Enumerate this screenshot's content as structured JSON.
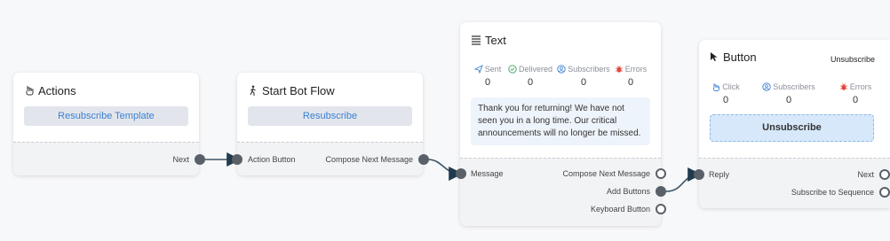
{
  "colors": {
    "accent": "#3b7fd1",
    "port": "#5a6068",
    "wire": "#3b5567",
    "error": "#e0483e",
    "success": "#3aa05b"
  },
  "nodes": {
    "actions": {
      "title": "Actions",
      "icon": "hand-pointer-icon",
      "button": "Resubscribe Template",
      "ports": {
        "next": "Next"
      }
    },
    "start_bot_flow": {
      "title": "Start Bot Flow",
      "icon": "walking-person-icon",
      "button": "Resubscribe",
      "ports": {
        "action_button": "Action Button",
        "compose_next": "Compose Next Message"
      }
    },
    "text": {
      "title": "Text",
      "icon": "lines-icon",
      "stats": [
        {
          "label": "Sent",
          "value": "0",
          "icon": "send-icon"
        },
        {
          "label": "Delivered",
          "value": "0",
          "icon": "check-circle-icon"
        },
        {
          "label": "Subscribers",
          "value": "0",
          "icon": "user-circle-icon"
        },
        {
          "label": "Errors",
          "value": "0",
          "icon": "bug-icon"
        }
      ],
      "message": "Thank you for returning! We have not seen you in a long time. Our critical announcements will no longer be missed.",
      "ports": {
        "message": "Message",
        "compose_next": "Compose Next Message",
        "add_buttons": "Add Buttons",
        "keyboard_button": "Keyboard Button"
      }
    },
    "button": {
      "title": "Button",
      "icon": "cursor-icon",
      "chip": "Unsubscribe",
      "stats": [
        {
          "label": "Click",
          "value": "0",
          "icon": "click-hand-icon"
        },
        {
          "label": "Subscribers",
          "value": "0",
          "icon": "user-circle-icon"
        },
        {
          "label": "Errors",
          "value": "0",
          "icon": "bug-icon"
        }
      ],
      "button": "Unsubscribe",
      "ports": {
        "reply": "Reply",
        "next": "Next",
        "subscribe_sequence": "Subscribe to Sequence"
      }
    }
  }
}
